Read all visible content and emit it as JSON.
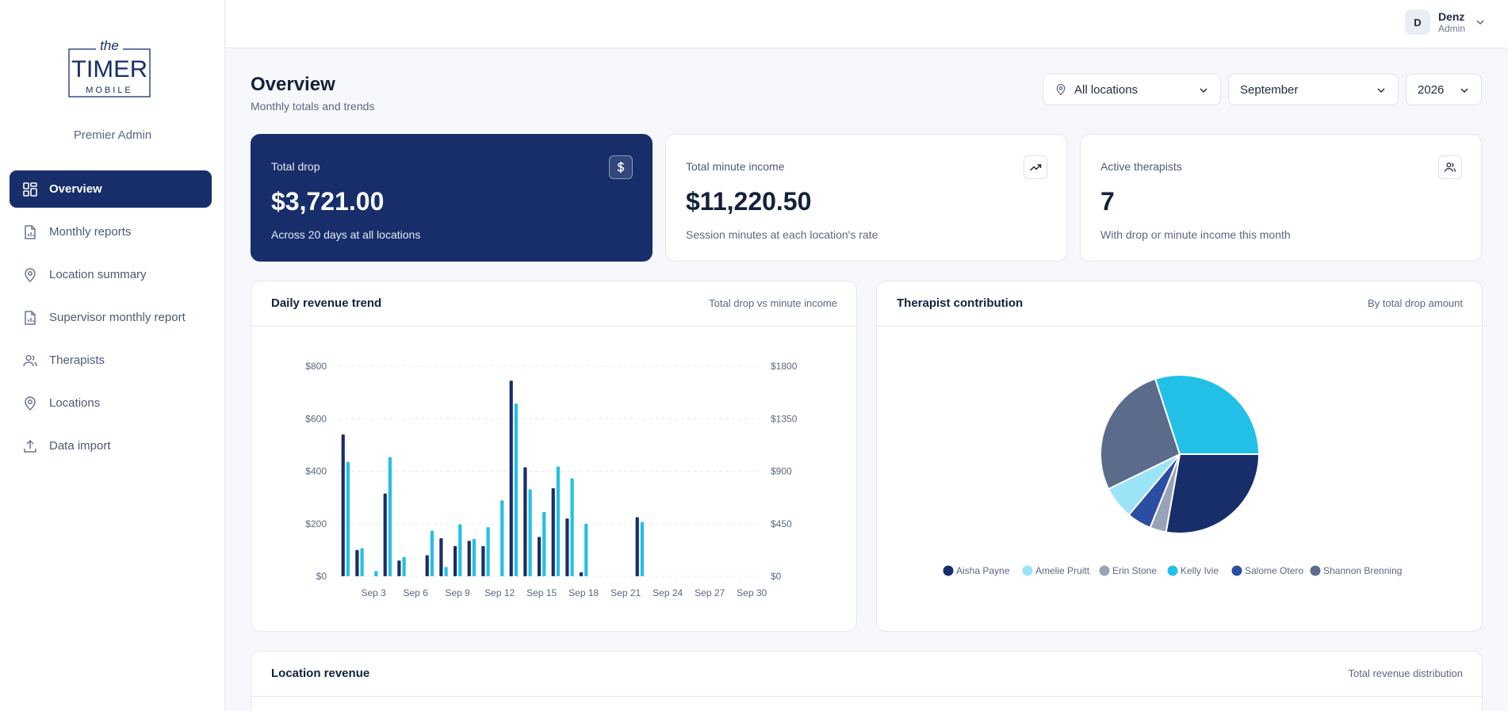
{
  "brand": {
    "logo_word_top": "the",
    "logo_word_main": "TIMER",
    "logo_word_bottom": "MOBILE",
    "subtitle": "Premier Admin",
    "navy": "#172e6a"
  },
  "nav": [
    {
      "label": "Overview",
      "icon": "grid-icon",
      "active": true
    },
    {
      "label": "Monthly reports",
      "icon": "report-icon"
    },
    {
      "label": "Location summary",
      "icon": "map-pin-icon"
    },
    {
      "label": "Supervisor monthly report",
      "icon": "report-icon"
    },
    {
      "label": "Therapists",
      "icon": "users-icon"
    },
    {
      "label": "Locations",
      "icon": "map-pin-icon"
    },
    {
      "label": "Data import",
      "icon": "upload-icon"
    }
  ],
  "user": {
    "initial": "D",
    "name": "Denz",
    "role": "Admin"
  },
  "header": {
    "title": "Overview",
    "subtitle": "Monthly totals and trends"
  },
  "filters": {
    "location": "All locations",
    "month": "September",
    "year": "2026"
  },
  "stats": [
    {
      "label": "Total drop",
      "value": "$3,721.00",
      "note": "Across 20 days at all locations",
      "icon": "dollar-icon"
    },
    {
      "label": "Total minute income",
      "value": "$11,220.50",
      "note": "Session minutes at each location's rate",
      "icon": "trending-up-icon"
    },
    {
      "label": "Active therapists",
      "value": "7",
      "note": "With drop or minute income this month",
      "icon": "users-icon"
    }
  ],
  "panels": {
    "revenue": {
      "title": "Daily revenue trend",
      "note": "Total drop vs minute income"
    },
    "contribution": {
      "title": "Therapist contribution",
      "note": "By total drop amount"
    },
    "location": {
      "title": "Location revenue",
      "note": "Total revenue distribution"
    }
  },
  "chart_data": [
    {
      "type": "bar",
      "title": "Daily revenue trend",
      "x": [
        1,
        2,
        3,
        4,
        5,
        6,
        7,
        8,
        9,
        10,
        11,
        12,
        13,
        14,
        15,
        16,
        17,
        18,
        19,
        20,
        21,
        22,
        23,
        24,
        25,
        26,
        27,
        28,
        29,
        30
      ],
      "x_ticks": [
        "Sep 3",
        "Sep 6",
        "Sep 9",
        "Sep 12",
        "Sep 15",
        "Sep 18",
        "Sep 21",
        "Sep 24",
        "Sep 27",
        "Sep 30"
      ],
      "series": [
        {
          "name": "Total drop",
          "axis": "left",
          "color": "#172e6a",
          "values": [
            540,
            100,
            0,
            315,
            60,
            0,
            80,
            145,
            115,
            135,
            115,
            0,
            745,
            415,
            150,
            335,
            220,
            15,
            0,
            0,
            0,
            225,
            0,
            0,
            0,
            0,
            0,
            0,
            0,
            0
          ]
        },
        {
          "name": "Minute income",
          "axis": "right",
          "color": "#22c0e6",
          "values": [
            980,
            240,
            45,
            1020,
            165,
            0,
            390,
            80,
            445,
            320,
            420,
            650,
            1480,
            745,
            550,
            940,
            840,
            450,
            0,
            0,
            0,
            465,
            0,
            0,
            0,
            0,
            0,
            0,
            0,
            0
          ]
        }
      ],
      "y_left": {
        "range": [
          0,
          800
        ],
        "ticks": [
          "$0",
          "$200",
          "$400",
          "$600",
          "$800"
        ]
      },
      "y_right": {
        "range": [
          0,
          1800
        ],
        "ticks": [
          "$0",
          "$450",
          "$900",
          "$1350",
          "$1800"
        ]
      },
      "grid": true,
      "legend": "none"
    },
    {
      "type": "pie",
      "title": "Therapist contribution",
      "legend": "bottom",
      "slices": [
        {
          "name": "Aisha Payne",
          "value": 25,
          "color": "#172e6a"
        },
        {
          "name": "Erin Stone",
          "value": 3,
          "color": "#98a2b8"
        },
        {
          "name": "Salome Otero",
          "value": 4.5,
          "color": "#2b4ea2"
        },
        {
          "name": "Amelie Pruitt",
          "value": 6,
          "color": "#9be3f7"
        },
        {
          "name": "Shannon Brenning",
          "value": 24.5,
          "color": "#5b6b8c"
        },
        {
          "name": "Kelly Ivie",
          "value": 27,
          "color": "#22c0e6"
        }
      ],
      "legend_order": [
        "Aisha Payne",
        "Amelie Pruitt",
        "Erin Stone",
        "Kelly Ivie",
        "Salome Otero",
        "Shannon Brenning"
      ]
    }
  ]
}
